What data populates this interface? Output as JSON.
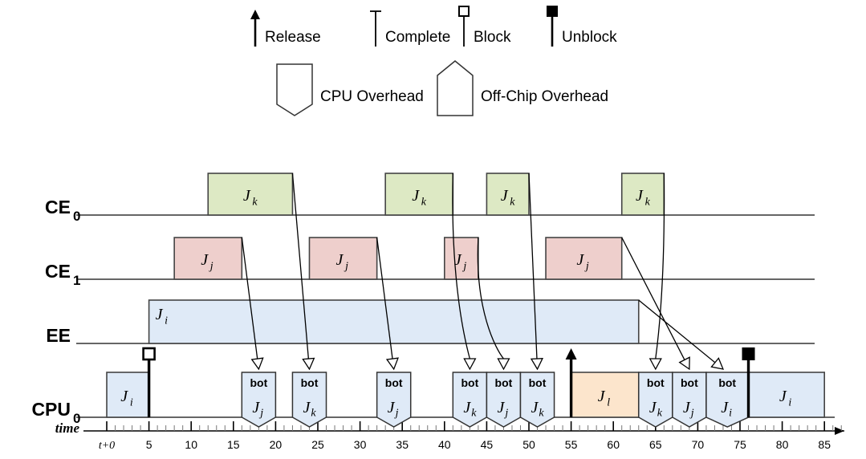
{
  "legend": {
    "symbols": [
      {
        "id": "release",
        "label": "Release",
        "icon": "up-arrow-icon"
      },
      {
        "id": "complete",
        "label": "Complete",
        "icon": "t-bar-icon"
      },
      {
        "id": "block",
        "label": "Block",
        "icon": "hollow-square-stem-icon"
      },
      {
        "id": "unblock",
        "label": "Unblock",
        "icon": "filled-square-stem-icon"
      }
    ],
    "shapes": [
      {
        "id": "cpu-overhead",
        "label": "CPU Overhead",
        "icon": "pentagon-down-icon"
      },
      {
        "id": "offchip-overhead",
        "label": "Off-Chip Overhead",
        "icon": "pentagon-up-icon"
      }
    ]
  },
  "axis": {
    "label": "time",
    "origin_label": "t+0",
    "ticks": [
      "t+0",
      "5",
      "10",
      "15",
      "20",
      "25",
      "30",
      "35",
      "40",
      "45",
      "50",
      "55",
      "60",
      "65",
      "70",
      "75",
      "80",
      "85"
    ],
    "tick_values": [
      0,
      5,
      10,
      15,
      20,
      25,
      30,
      35,
      40,
      45,
      50,
      55,
      60,
      65,
      70,
      75,
      80,
      85
    ],
    "minor_step": 1,
    "range": [
      0,
      87
    ]
  },
  "rows": [
    {
      "id": "ce0",
      "name": "CE",
      "sub": "0"
    },
    {
      "id": "ce1",
      "name": "CE",
      "sub": "1"
    },
    {
      "id": "ee",
      "name": "EE",
      "sub": ""
    },
    {
      "id": "cpu",
      "name": "CPU",
      "sub": "0"
    }
  ],
  "colors": {
    "green": "#dde9c4",
    "pink": "#eecfcc",
    "blue": "#dfeaf7",
    "orange": "#fce5cc",
    "stroke": "#444444"
  },
  "chart_data": {
    "type": "gantt",
    "title": "",
    "xlabel": "time",
    "xlim": [
      0,
      87
    ],
    "rows": [
      "CE0",
      "CE1",
      "EE",
      "CPU0"
    ],
    "blocks": [
      {
        "row": "ce0",
        "label": "J",
        "sub": "k",
        "start": 12,
        "end": 22,
        "color": "green"
      },
      {
        "row": "ce0",
        "label": "J",
        "sub": "k",
        "start": 33,
        "end": 41,
        "color": "green"
      },
      {
        "row": "ce0",
        "label": "J",
        "sub": "k",
        "start": 45,
        "end": 50,
        "color": "green"
      },
      {
        "row": "ce0",
        "label": "J",
        "sub": "k",
        "start": 61,
        "end": 66,
        "color": "green"
      },
      {
        "row": "ce1",
        "label": "J",
        "sub": "j",
        "start": 8,
        "end": 16,
        "color": "pink"
      },
      {
        "row": "ce1",
        "label": "J",
        "sub": "j",
        "start": 24,
        "end": 32,
        "color": "pink"
      },
      {
        "row": "ce1",
        "label": "J",
        "sub": "j",
        "start": 40,
        "end": 44,
        "color": "pink"
      },
      {
        "row": "ce1",
        "label": "J",
        "sub": "j",
        "start": 52,
        "end": 61,
        "color": "pink"
      },
      {
        "row": "ee",
        "label": "J",
        "sub": "i",
        "start": 5,
        "end": 63,
        "color": "blue"
      },
      {
        "row": "cpu",
        "label": "J",
        "sub": "i",
        "start": 0,
        "end": 5,
        "color": "blue",
        "shape": "rect"
      },
      {
        "row": "cpu",
        "label": "J",
        "sub": "l",
        "start": 55,
        "end": 63,
        "color": "orange",
        "shape": "rect"
      },
      {
        "row": "cpu",
        "label": "J",
        "sub": "i",
        "start": 76,
        "end": 85,
        "color": "blue",
        "shape": "rect"
      }
    ],
    "overheads": [
      {
        "row": "cpu",
        "top": "bot",
        "label": "J",
        "sub": "j",
        "start": 16,
        "end": 20,
        "color": "blue"
      },
      {
        "row": "cpu",
        "top": "bot",
        "label": "J",
        "sub": "k",
        "start": 22,
        "end": 26,
        "color": "blue"
      },
      {
        "row": "cpu",
        "top": "bot",
        "label": "J",
        "sub": "j",
        "start": 32,
        "end": 36,
        "color": "blue"
      },
      {
        "row": "cpu",
        "top": "bot",
        "label": "J",
        "sub": "k",
        "start": 41,
        "end": 45,
        "color": "blue"
      },
      {
        "row": "cpu",
        "top": "bot",
        "label": "J",
        "sub": "j",
        "start": 45,
        "end": 49,
        "color": "blue"
      },
      {
        "row": "cpu",
        "top": "bot",
        "label": "J",
        "sub": "k",
        "start": 49,
        "end": 53,
        "color": "blue"
      },
      {
        "row": "cpu",
        "top": "bot",
        "label": "J",
        "sub": "k",
        "start": 63,
        "end": 67,
        "color": "blue"
      },
      {
        "row": "cpu",
        "top": "bot",
        "label": "J",
        "sub": "j",
        "start": 67,
        "end": 71,
        "color": "blue"
      },
      {
        "row": "cpu",
        "top": "bot",
        "label": "J",
        "sub": "i",
        "start": 71,
        "end": 76,
        "color": "blue"
      }
    ],
    "markers": [
      {
        "type": "block",
        "row": "cpu",
        "at": 5
      },
      {
        "type": "release",
        "row": "cpu",
        "at": 55
      },
      {
        "type": "unblock",
        "row": "cpu",
        "at": 76
      }
    ],
    "arrows": [
      {
        "from_row": "ce1",
        "from_t": 16,
        "to_t": 18,
        "kind": "straight"
      },
      {
        "from_row": "ce0",
        "from_t": 22,
        "to_t": 24,
        "kind": "straight"
      },
      {
        "from_row": "ce1",
        "from_t": 32,
        "to_t": 34,
        "kind": "straight"
      },
      {
        "from_row": "ce0",
        "from_t": 41,
        "to_t": 43,
        "kind": "curve"
      },
      {
        "from_row": "ce1",
        "from_t": 44,
        "to_t": 47,
        "kind": "curve"
      },
      {
        "from_row": "ce0",
        "from_t": 50,
        "to_t": 51,
        "kind": "straight"
      },
      {
        "from_row": "ce0",
        "from_t": 66,
        "to_t": 65,
        "kind": "curve"
      },
      {
        "from_row": "ce1",
        "from_t": 61,
        "to_t": 69,
        "kind": "straight"
      },
      {
        "from_row": "ee",
        "from_t": 63,
        "to_t": 73,
        "kind": "straight"
      }
    ]
  }
}
